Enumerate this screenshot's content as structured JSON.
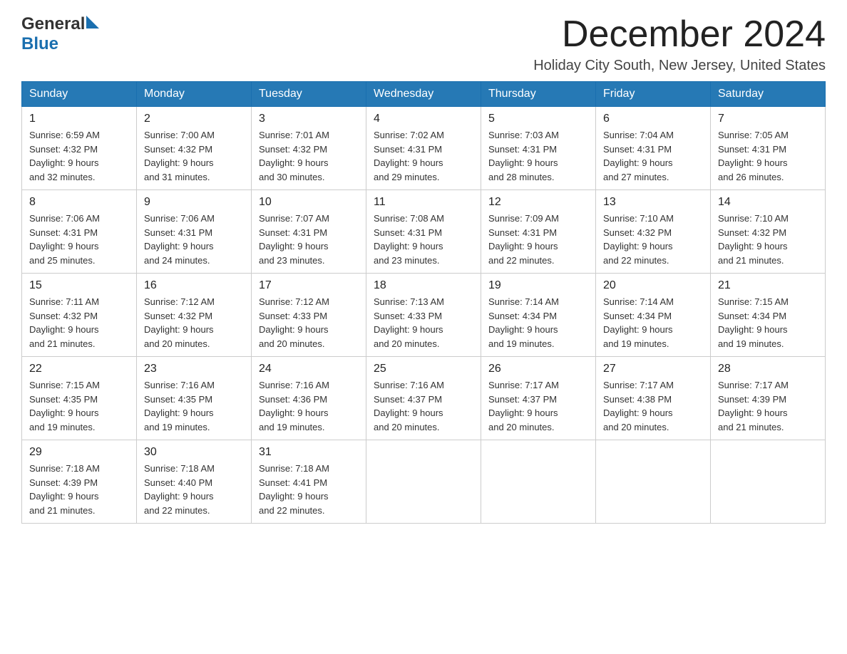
{
  "header": {
    "logo_general": "General",
    "logo_blue": "Blue",
    "month_title": "December 2024",
    "subtitle": "Holiday City South, New Jersey, United States"
  },
  "days_of_week": [
    "Sunday",
    "Monday",
    "Tuesday",
    "Wednesday",
    "Thursday",
    "Friday",
    "Saturday"
  ],
  "weeks": [
    [
      {
        "day": "1",
        "sunrise": "6:59 AM",
        "sunset": "4:32 PM",
        "daylight": "9 hours and 32 minutes."
      },
      {
        "day": "2",
        "sunrise": "7:00 AM",
        "sunset": "4:32 PM",
        "daylight": "9 hours and 31 minutes."
      },
      {
        "day": "3",
        "sunrise": "7:01 AM",
        "sunset": "4:32 PM",
        "daylight": "9 hours and 30 minutes."
      },
      {
        "day": "4",
        "sunrise": "7:02 AM",
        "sunset": "4:31 PM",
        "daylight": "9 hours and 29 minutes."
      },
      {
        "day": "5",
        "sunrise": "7:03 AM",
        "sunset": "4:31 PM",
        "daylight": "9 hours and 28 minutes."
      },
      {
        "day": "6",
        "sunrise": "7:04 AM",
        "sunset": "4:31 PM",
        "daylight": "9 hours and 27 minutes."
      },
      {
        "day": "7",
        "sunrise": "7:05 AM",
        "sunset": "4:31 PM",
        "daylight": "9 hours and 26 minutes."
      }
    ],
    [
      {
        "day": "8",
        "sunrise": "7:06 AM",
        "sunset": "4:31 PM",
        "daylight": "9 hours and 25 minutes."
      },
      {
        "day": "9",
        "sunrise": "7:06 AM",
        "sunset": "4:31 PM",
        "daylight": "9 hours and 24 minutes."
      },
      {
        "day": "10",
        "sunrise": "7:07 AM",
        "sunset": "4:31 PM",
        "daylight": "9 hours and 23 minutes."
      },
      {
        "day": "11",
        "sunrise": "7:08 AM",
        "sunset": "4:31 PM",
        "daylight": "9 hours and 23 minutes."
      },
      {
        "day": "12",
        "sunrise": "7:09 AM",
        "sunset": "4:31 PM",
        "daylight": "9 hours and 22 minutes."
      },
      {
        "day": "13",
        "sunrise": "7:10 AM",
        "sunset": "4:32 PM",
        "daylight": "9 hours and 22 minutes."
      },
      {
        "day": "14",
        "sunrise": "7:10 AM",
        "sunset": "4:32 PM",
        "daylight": "9 hours and 21 minutes."
      }
    ],
    [
      {
        "day": "15",
        "sunrise": "7:11 AM",
        "sunset": "4:32 PM",
        "daylight": "9 hours and 21 minutes."
      },
      {
        "day": "16",
        "sunrise": "7:12 AM",
        "sunset": "4:32 PM",
        "daylight": "9 hours and 20 minutes."
      },
      {
        "day": "17",
        "sunrise": "7:12 AM",
        "sunset": "4:33 PM",
        "daylight": "9 hours and 20 minutes."
      },
      {
        "day": "18",
        "sunrise": "7:13 AM",
        "sunset": "4:33 PM",
        "daylight": "9 hours and 20 minutes."
      },
      {
        "day": "19",
        "sunrise": "7:14 AM",
        "sunset": "4:34 PM",
        "daylight": "9 hours and 19 minutes."
      },
      {
        "day": "20",
        "sunrise": "7:14 AM",
        "sunset": "4:34 PM",
        "daylight": "9 hours and 19 minutes."
      },
      {
        "day": "21",
        "sunrise": "7:15 AM",
        "sunset": "4:34 PM",
        "daylight": "9 hours and 19 minutes."
      }
    ],
    [
      {
        "day": "22",
        "sunrise": "7:15 AM",
        "sunset": "4:35 PM",
        "daylight": "9 hours and 19 minutes."
      },
      {
        "day": "23",
        "sunrise": "7:16 AM",
        "sunset": "4:35 PM",
        "daylight": "9 hours and 19 minutes."
      },
      {
        "day": "24",
        "sunrise": "7:16 AM",
        "sunset": "4:36 PM",
        "daylight": "9 hours and 19 minutes."
      },
      {
        "day": "25",
        "sunrise": "7:16 AM",
        "sunset": "4:37 PM",
        "daylight": "9 hours and 20 minutes."
      },
      {
        "day": "26",
        "sunrise": "7:17 AM",
        "sunset": "4:37 PM",
        "daylight": "9 hours and 20 minutes."
      },
      {
        "day": "27",
        "sunrise": "7:17 AM",
        "sunset": "4:38 PM",
        "daylight": "9 hours and 20 minutes."
      },
      {
        "day": "28",
        "sunrise": "7:17 AM",
        "sunset": "4:39 PM",
        "daylight": "9 hours and 21 minutes."
      }
    ],
    [
      {
        "day": "29",
        "sunrise": "7:18 AM",
        "sunset": "4:39 PM",
        "daylight": "9 hours and 21 minutes."
      },
      {
        "day": "30",
        "sunrise": "7:18 AM",
        "sunset": "4:40 PM",
        "daylight": "9 hours and 22 minutes."
      },
      {
        "day": "31",
        "sunrise": "7:18 AM",
        "sunset": "4:41 PM",
        "daylight": "9 hours and 22 minutes."
      },
      null,
      null,
      null,
      null
    ]
  ],
  "labels": {
    "sunrise": "Sunrise:",
    "sunset": "Sunset:",
    "daylight": "Daylight:"
  }
}
